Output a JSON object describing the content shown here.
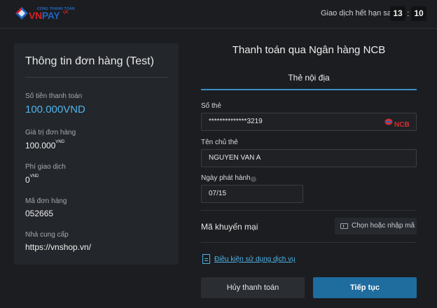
{
  "header": {
    "brand": {
      "small_text": "CỔNG THANH TOÁN",
      "vn": "VN",
      "pay": "PAY",
      "qr": "QR"
    },
    "expire_label": "Giao dịch hết hạn sau",
    "timer": {
      "minutes": "13",
      "separator": ":",
      "seconds": "10"
    }
  },
  "order": {
    "title": "Thông tin đơn hàng (Test)",
    "fields": [
      {
        "label": "Số tiền thanh toán",
        "value": "100.000VND"
      },
      {
        "label": "Giá trị đơn hàng",
        "value": "100.000",
        "unit": "VND"
      },
      {
        "label": "Phí giao dịch",
        "value": "0",
        "unit": "VND"
      },
      {
        "label": "Mã đơn hàng",
        "value": "052665"
      },
      {
        "label": "Nhà cung cấp",
        "value": "https://vnshop.vn/"
      }
    ]
  },
  "payment": {
    "title": "Thanh toán qua Ngân hàng NCB",
    "tab_label": "Thẻ nội địa",
    "card_number": {
      "label": "Số thẻ",
      "value": "**************3219",
      "bank_logo": "NCB"
    },
    "card_holder": {
      "label": "Tên chủ thẻ",
      "value": "NGUYEN VAN A"
    },
    "issue_date": {
      "label": "Ngày phát hành",
      "value": "07/15",
      "info_icon": "i"
    },
    "promo": {
      "label": "Mã khuyến mại",
      "button_label": "Chọn hoặc nhập mã"
    },
    "terms_link": "Điều kiện sử dụng dịch vụ",
    "cancel_button": "Hủy thanh toán",
    "continue_button": "Tiếp tục"
  },
  "colors": {
    "accent": "#4fb3ea",
    "primary_button": "#1f6c9f",
    "brand_red": "#d71f26",
    "brand_blue": "#1f64c3"
  }
}
